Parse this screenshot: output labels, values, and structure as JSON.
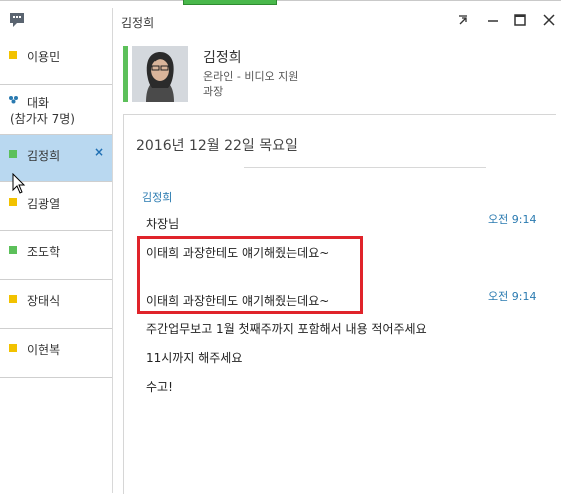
{
  "window": {
    "title": "김정희"
  },
  "sidebar": {
    "items": [
      {
        "label": "이용민",
        "status_color": "#f2c200"
      },
      {
        "label": "대화\n(참가자 7명)",
        "status_color": "#2a7ab0"
      },
      {
        "label": "김정희",
        "status_color": "#5cc05a"
      },
      {
        "label": "김광열",
        "status_color": "#f2c200"
      },
      {
        "label": "조도학",
        "status_color": "#5cc05a"
      },
      {
        "label": "장태식",
        "status_color": "#f2c200"
      },
      {
        "label": "이현복",
        "status_color": "#f2c200"
      }
    ],
    "group_line1": "대화",
    "group_line2": "(참가자 7명)",
    "close_glyph": "×"
  },
  "contact": {
    "name": "김정희",
    "status": "온라인 - 비디오 지원",
    "job_title": "과장"
  },
  "conversation": {
    "date": "2016년 12월 22일 목요일",
    "sender": "김정희",
    "messages": [
      {
        "text": "차장님",
        "time": "오전 9:14"
      },
      {
        "text": "이태희 과장한테도 얘기해줬는데요~",
        "time": ""
      },
      {
        "text": "이태희 과장한테도 얘기해줬는데요~",
        "time": "오전 9:14"
      },
      {
        "text": "주간업무보고 1월 첫째주까지 포함해서 내용 적어주세요",
        "time": ""
      },
      {
        "text": "11시까지 해주세요",
        "time": ""
      },
      {
        "text": "수고!",
        "time": ""
      }
    ]
  },
  "colors": {
    "accent_blue": "#2a7ab0",
    "online_green": "#5cc05a",
    "away_yellow": "#f2c200",
    "highlight_red": "#e0232a",
    "selected_bg": "#b9d8f0"
  }
}
